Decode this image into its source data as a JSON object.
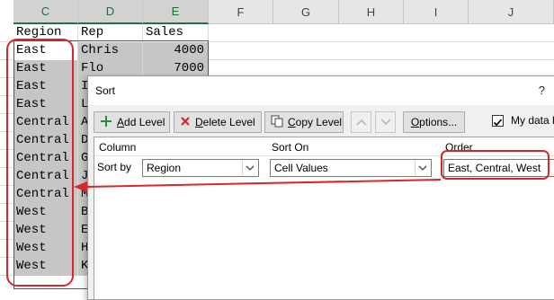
{
  "sheet": {
    "columns": [
      {
        "label": "C",
        "selected": true
      },
      {
        "label": "D",
        "selected": true
      },
      {
        "label": "E",
        "selected": true
      },
      {
        "label": "F",
        "selected": false
      },
      {
        "label": "G",
        "selected": false
      },
      {
        "label": "H",
        "selected": false
      },
      {
        "label": "I",
        "selected": false
      },
      {
        "label": "J",
        "selected": false
      }
    ],
    "header_row": {
      "c": "Region",
      "d": "Rep",
      "e": "Sales"
    },
    "rows": [
      {
        "c": "East",
        "d": "Chris",
        "e": "4000"
      },
      {
        "c": "East",
        "d": "Flo",
        "e": "7000"
      },
      {
        "c": "East",
        "d": "I",
        "e": ""
      },
      {
        "c": "East",
        "d": "L",
        "e": ""
      },
      {
        "c": "Central",
        "d": "A",
        "e": ""
      },
      {
        "c": "Central",
        "d": "D",
        "e": ""
      },
      {
        "c": "Central",
        "d": "G",
        "e": ""
      },
      {
        "c": "Central",
        "d": "J",
        "e": ""
      },
      {
        "c": "Central",
        "d": "M",
        "e": ""
      },
      {
        "c": "West",
        "d": "B",
        "e": ""
      },
      {
        "c": "West",
        "d": "E",
        "e": ""
      },
      {
        "c": "West",
        "d": "H",
        "e": ""
      },
      {
        "c": "West",
        "d": "K",
        "e": ""
      }
    ]
  },
  "dialog": {
    "title": "Sort",
    "help": "?",
    "toolbar": {
      "add_level_accel": "A",
      "add_level_rest": "dd Level",
      "delete_level_accel": "D",
      "delete_level_rest": "elete Level",
      "copy_level_accel": "C",
      "copy_level_rest": "opy Level",
      "options_accel": "O",
      "options_rest": "ptions...",
      "move_up_icon": "chevron-up-icon",
      "move_down_icon": "chevron-down-icon"
    },
    "my_data_headers": {
      "label": "My data h",
      "checked": true
    },
    "columns": {
      "column": "Column",
      "sort_on": "Sort On",
      "order": "Order"
    },
    "level": {
      "sort_by_label": "Sort by",
      "column_value": "Region",
      "sort_on_value": "Cell Values",
      "order_value": "East, Central, West"
    }
  },
  "annotation": {
    "color": "#d8262c"
  },
  "colors": {
    "excel_green": "#217346",
    "selection_gray": "#c6c6c6"
  }
}
